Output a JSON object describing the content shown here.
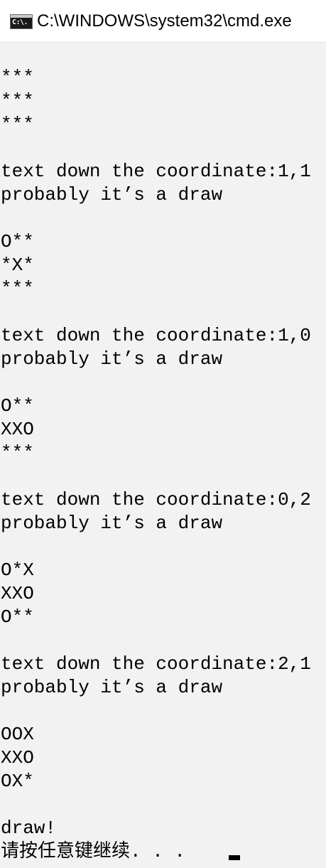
{
  "window": {
    "title": "C:\\WINDOWS\\system32\\cmd.exe",
    "icon": "cmd-icon",
    "icon_text": "C:\\."
  },
  "console": {
    "lines": [
      "",
      "***",
      "***",
      "***",
      "",
      "text down the coordinate:1,1",
      "probably it’s a draw",
      "",
      "O**",
      "*X*",
      "***",
      "",
      "text down the coordinate:1,0",
      "probably it’s a draw",
      "",
      "O**",
      "XXO",
      "***",
      "",
      "text down the coordinate:0,2",
      "probably it’s a draw",
      "",
      "O*X",
      "XXO",
      "O**",
      "",
      "text down the coordinate:2,1",
      "probably it’s a draw",
      "",
      "OOX",
      "XXO",
      "OX*",
      "",
      "draw!",
      "请按任意键继续. . . "
    ]
  },
  "colors": {
    "console_background": "#f2f2f2",
    "console_text": "#000000",
    "titlebar_background": "#ffffff"
  }
}
